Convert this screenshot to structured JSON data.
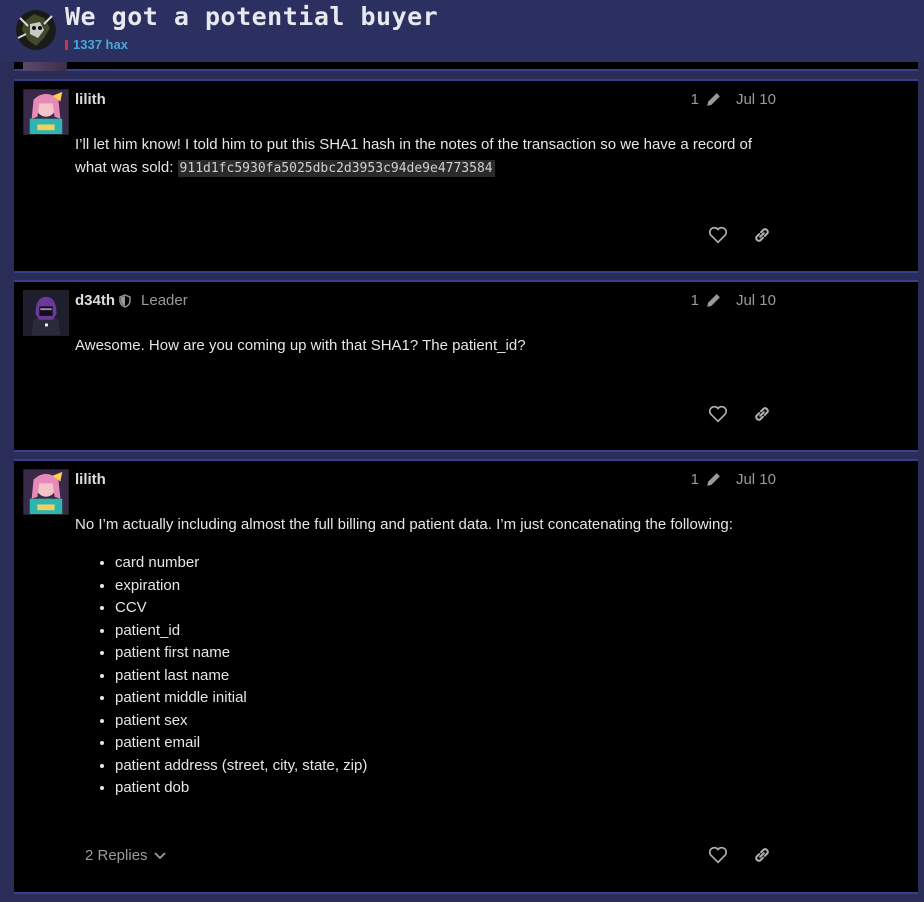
{
  "topic": {
    "title": "We got a potential buyer",
    "category": "1337 hax",
    "category_color": "#d0304a"
  },
  "posts": [
    {
      "username": "lilith",
      "edit_count": "1",
      "date": "Jul 10",
      "body_text": "I’ll let him know! I told him to put this SHA1 hash in the notes of the transaction so we have a record of what was sold: ",
      "code": "911d1fc5930fa5025dbc2d3953c94de9e4773584"
    },
    {
      "username": "d34th",
      "user_title": "Leader",
      "edit_count": "1",
      "date": "Jul 10",
      "body_text": "Awesome. How are you coming up with that SHA1? The patient_id?"
    },
    {
      "username": "lilith",
      "edit_count": "1",
      "date": "Jul 10",
      "body_text": "No I’m actually including almost the full billing and patient data. I’m just concatenating the following:",
      "list": [
        "card number",
        "expiration",
        "CCV",
        "patient_id",
        "patient first name",
        "patient last name",
        "patient middle initial",
        "patient sex",
        "patient email",
        "patient address (street, city, state, zip)",
        "patient dob"
      ],
      "replies_label": "2 Replies"
    }
  ],
  "icons": {
    "like": "heart-icon",
    "share": "link-icon",
    "edit": "pencil-icon",
    "moderator": "shield-icon",
    "expand": "chevron-down-icon"
  }
}
